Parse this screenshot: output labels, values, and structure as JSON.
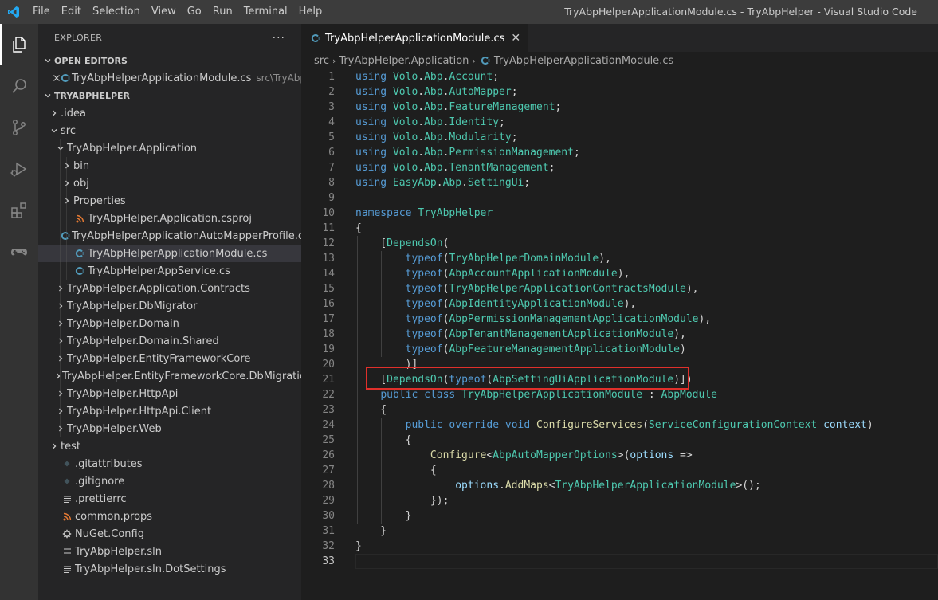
{
  "titlebar": {
    "menu": [
      "File",
      "Edit",
      "Selection",
      "View",
      "Go",
      "Run",
      "Terminal",
      "Help"
    ],
    "window_title": "TryAbpHelperApplicationModule.cs - TryAbpHelper - Visual Studio Code"
  },
  "activity_bar": [
    "explorer-icon",
    "search-icon",
    "source-control-icon",
    "run-debug-icon",
    "extensions-icon",
    "gamepad-icon"
  ],
  "sidebar": {
    "title": "EXPLORER",
    "more": "···",
    "open_editors": {
      "label": "OPEN EDITORS",
      "items": [
        {
          "name": "TryAbpHelperApplicationModule.cs",
          "path": "src\\TryAbp..."
        }
      ]
    },
    "project": {
      "label": "TRYABPHELPER",
      "rows": [
        {
          "label": ".idea"
        },
        {
          "label": "src"
        },
        {
          "label": "TryAbpHelper.Application"
        },
        {
          "label": "bin"
        },
        {
          "label": "obj"
        },
        {
          "label": "Properties"
        },
        {
          "label": "TryAbpHelper.Application.csproj"
        },
        {
          "label": "TryAbpHelperApplicationAutoMapperProfile.cs"
        },
        {
          "label": "TryAbpHelperApplicationModule.cs"
        },
        {
          "label": "TryAbpHelperAppService.cs"
        },
        {
          "label": "TryAbpHelper.Application.Contracts"
        },
        {
          "label": "TryAbpHelper.DbMigrator"
        },
        {
          "label": "TryAbpHelper.Domain"
        },
        {
          "label": "TryAbpHelper.Domain.Shared"
        },
        {
          "label": "TryAbpHelper.EntityFrameworkCore"
        },
        {
          "label": "TryAbpHelper.EntityFrameworkCore.DbMigrations"
        },
        {
          "label": "TryAbpHelper.HttpApi"
        },
        {
          "label": "TryAbpHelper.HttpApi.Client"
        },
        {
          "label": "TryAbpHelper.Web"
        },
        {
          "label": "test"
        },
        {
          "label": ".gitattributes"
        },
        {
          "label": ".gitignore"
        },
        {
          "label": ".prettierrc"
        },
        {
          "label": "common.props"
        },
        {
          "label": "NuGet.Config"
        },
        {
          "label": "TryAbpHelper.sln"
        },
        {
          "label": "TryAbpHelper.sln.DotSettings"
        }
      ]
    }
  },
  "editor": {
    "tab": {
      "label": "TryAbpHelperApplicationModule.cs",
      "close": "✕"
    },
    "breadcrumb": [
      "src",
      "TryAbpHelper.Application",
      "TryAbpHelperApplicationModule.cs"
    ],
    "current_line": 33,
    "lines": [
      [
        [
          "kw",
          "using"
        ],
        [
          "pl",
          " "
        ],
        [
          "ty",
          "Volo"
        ],
        [
          "pl",
          "."
        ],
        [
          "ty",
          "Abp"
        ],
        [
          "pl",
          "."
        ],
        [
          "ty",
          "Account"
        ],
        [
          "pl",
          ";"
        ]
      ],
      [
        [
          "kw",
          "using"
        ],
        [
          "pl",
          " "
        ],
        [
          "ty",
          "Volo"
        ],
        [
          "pl",
          "."
        ],
        [
          "ty",
          "Abp"
        ],
        [
          "pl",
          "."
        ],
        [
          "ty",
          "AutoMapper"
        ],
        [
          "pl",
          ";"
        ]
      ],
      [
        [
          "kw",
          "using"
        ],
        [
          "pl",
          " "
        ],
        [
          "ty",
          "Volo"
        ],
        [
          "pl",
          "."
        ],
        [
          "ty",
          "Abp"
        ],
        [
          "pl",
          "."
        ],
        [
          "ty",
          "FeatureManagement"
        ],
        [
          "pl",
          ";"
        ]
      ],
      [
        [
          "kw",
          "using"
        ],
        [
          "pl",
          " "
        ],
        [
          "ty",
          "Volo"
        ],
        [
          "pl",
          "."
        ],
        [
          "ty",
          "Abp"
        ],
        [
          "pl",
          "."
        ],
        [
          "ty",
          "Identity"
        ],
        [
          "pl",
          ";"
        ]
      ],
      [
        [
          "kw",
          "using"
        ],
        [
          "pl",
          " "
        ],
        [
          "ty",
          "Volo"
        ],
        [
          "pl",
          "."
        ],
        [
          "ty",
          "Abp"
        ],
        [
          "pl",
          "."
        ],
        [
          "ty",
          "Modularity"
        ],
        [
          "pl",
          ";"
        ]
      ],
      [
        [
          "kw",
          "using"
        ],
        [
          "pl",
          " "
        ],
        [
          "ty",
          "Volo"
        ],
        [
          "pl",
          "."
        ],
        [
          "ty",
          "Abp"
        ],
        [
          "pl",
          "."
        ],
        [
          "ty",
          "PermissionManagement"
        ],
        [
          "pl",
          ";"
        ]
      ],
      [
        [
          "kw",
          "using"
        ],
        [
          "pl",
          " "
        ],
        [
          "ty",
          "Volo"
        ],
        [
          "pl",
          "."
        ],
        [
          "ty",
          "Abp"
        ],
        [
          "pl",
          "."
        ],
        [
          "ty",
          "TenantManagement"
        ],
        [
          "pl",
          ";"
        ]
      ],
      [
        [
          "kw",
          "using"
        ],
        [
          "pl",
          " "
        ],
        [
          "ty",
          "EasyAbp"
        ],
        [
          "pl",
          "."
        ],
        [
          "ty",
          "Abp"
        ],
        [
          "pl",
          "."
        ],
        [
          "ty",
          "SettingUi"
        ],
        [
          "pl",
          ";"
        ]
      ],
      [],
      [
        [
          "kw",
          "namespace"
        ],
        [
          "pl",
          " "
        ],
        [
          "ty",
          "TryAbpHelper"
        ]
      ],
      [
        [
          "pl",
          "{"
        ]
      ],
      [
        [
          "pl",
          "    ["
        ],
        [
          "ty",
          "DependsOn"
        ],
        [
          "pl",
          "("
        ]
      ],
      [
        [
          "pl",
          "        "
        ],
        [
          "kw",
          "typeof"
        ],
        [
          "pl",
          "("
        ],
        [
          "ty",
          "TryAbpHelperDomainModule"
        ],
        [
          "pl",
          "),"
        ]
      ],
      [
        [
          "pl",
          "        "
        ],
        [
          "kw",
          "typeof"
        ],
        [
          "pl",
          "("
        ],
        [
          "ty",
          "AbpAccountApplicationModule"
        ],
        [
          "pl",
          "),"
        ]
      ],
      [
        [
          "pl",
          "        "
        ],
        [
          "kw",
          "typeof"
        ],
        [
          "pl",
          "("
        ],
        [
          "ty",
          "TryAbpHelperApplicationContractsModule"
        ],
        [
          "pl",
          "),"
        ]
      ],
      [
        [
          "pl",
          "        "
        ],
        [
          "kw",
          "typeof"
        ],
        [
          "pl",
          "("
        ],
        [
          "ty",
          "AbpIdentityApplicationModule"
        ],
        [
          "pl",
          "),"
        ]
      ],
      [
        [
          "pl",
          "        "
        ],
        [
          "kw",
          "typeof"
        ],
        [
          "pl",
          "("
        ],
        [
          "ty",
          "AbpPermissionManagementApplicationModule"
        ],
        [
          "pl",
          "),"
        ]
      ],
      [
        [
          "pl",
          "        "
        ],
        [
          "kw",
          "typeof"
        ],
        [
          "pl",
          "("
        ],
        [
          "ty",
          "AbpTenantManagementApplicationModule"
        ],
        [
          "pl",
          "),"
        ]
      ],
      [
        [
          "pl",
          "        "
        ],
        [
          "kw",
          "typeof"
        ],
        [
          "pl",
          "("
        ],
        [
          "ty",
          "AbpFeatureManagementApplicationModule"
        ],
        [
          "pl",
          ")"
        ]
      ],
      [
        [
          "pl",
          "        )]"
        ]
      ],
      [
        [
          "pl",
          "    ["
        ],
        [
          "ty",
          "DependsOn"
        ],
        [
          "pl",
          "("
        ],
        [
          "kw",
          "typeof"
        ],
        [
          "pl",
          "("
        ],
        [
          "ty",
          "AbpSettingUiApplicationModule"
        ],
        [
          "pl",
          ")])"
        ]
      ],
      [
        [
          "pl",
          "    "
        ],
        [
          "kw",
          "public"
        ],
        [
          "pl",
          " "
        ],
        [
          "kw",
          "class"
        ],
        [
          "pl",
          " "
        ],
        [
          "ty",
          "TryAbpHelperApplicationModule"
        ],
        [
          "pl",
          " : "
        ],
        [
          "ty",
          "AbpModule"
        ]
      ],
      [
        [
          "pl",
          "    {"
        ]
      ],
      [
        [
          "pl",
          "        "
        ],
        [
          "kw",
          "public"
        ],
        [
          "pl",
          " "
        ],
        [
          "kw",
          "override"
        ],
        [
          "pl",
          " "
        ],
        [
          "kw",
          "void"
        ],
        [
          "pl",
          " "
        ],
        [
          "fn",
          "ConfigureServices"
        ],
        [
          "pl",
          "("
        ],
        [
          "ty",
          "ServiceConfigurationContext"
        ],
        [
          "pl",
          " "
        ],
        [
          "id",
          "context"
        ],
        [
          "pl",
          ")"
        ]
      ],
      [
        [
          "pl",
          "        {"
        ]
      ],
      [
        [
          "pl",
          "            "
        ],
        [
          "fn",
          "Configure"
        ],
        [
          "pl",
          "<"
        ],
        [
          "ty",
          "AbpAutoMapperOptions"
        ],
        [
          "pl",
          ">("
        ],
        [
          "id",
          "options"
        ],
        [
          "pl",
          " =>"
        ]
      ],
      [
        [
          "pl",
          "            {"
        ]
      ],
      [
        [
          "pl",
          "                "
        ],
        [
          "id",
          "options"
        ],
        [
          "pl",
          "."
        ],
        [
          "fn",
          "AddMaps"
        ],
        [
          "pl",
          "<"
        ],
        [
          "ty",
          "TryAbpHelperApplicationModule"
        ],
        [
          "pl",
          ">();"
        ]
      ],
      [
        [
          "pl",
          "            });"
        ]
      ],
      [
        [
          "pl",
          "        }"
        ]
      ],
      [
        [
          "pl",
          "    }"
        ]
      ],
      [
        [
          "pl",
          "}"
        ]
      ],
      []
    ]
  }
}
